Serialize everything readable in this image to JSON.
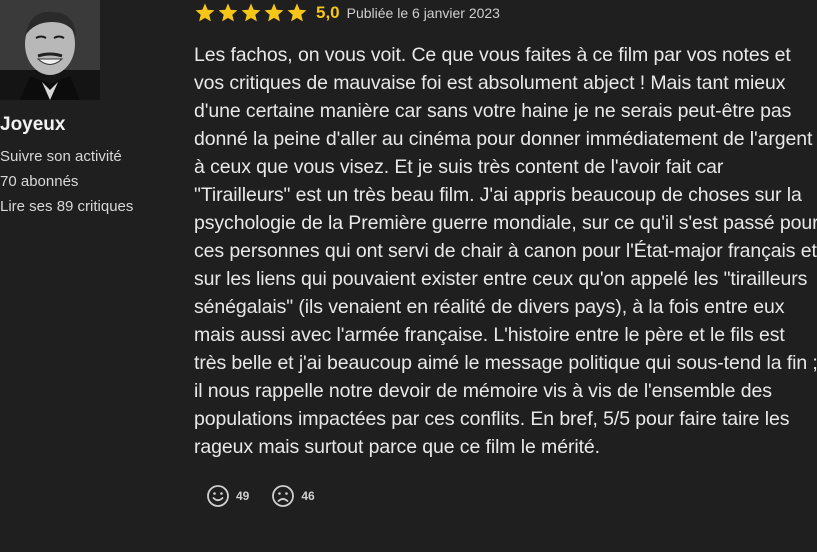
{
  "user": {
    "name": "Joyeux",
    "follow_label": "Suivre son activité",
    "followers_label": "70 abonnés",
    "reviews_label": "Lire ses 89 critiques"
  },
  "review": {
    "rating_value": 5,
    "rating_max": 5,
    "rating_label": "5,0",
    "published": "Publiée le 6 janvier 2023",
    "text": "Les fachos, on vous voit. Ce que vous faites à ce film par vos notes et vos critiques de mauvaise foi est absolument abject ! Mais tant mieux d'une certaine manière car sans votre haine je ne serais peut-être pas donné la peine d'aller au cinéma pour donner immédiatement de l'argent à ceux que vous visez. Et je suis très content de l'avoir fait car \"Tirailleurs\" est un très beau film. J'ai appris beaucoup de choses sur la psychologie de la Première guerre mondiale, sur ce qu'il s'est passé pour ces personnes qui ont servi de chair à canon pour l'État-major français et sur les liens qui pouvaient exister entre ceux qu'on appelé les \"tirailleurs sénégalais\" (ils venaient en réalité de divers pays), à la fois entre eux mais aussi avec l'armée française. L'histoire entre le père et le fils est très belle et j'ai beaucoup aimé le message politique qui sous-tend la fin ; il nous rappelle notre devoir de mémoire vis à vis de l'ensemble des populations impactées par ces conflits. En bref, 5/5 pour faire taire les rageux mais surtout parce que ce film le mérité."
  },
  "reactions": {
    "helpful_count": "49",
    "unhelpful_count": "46",
    "helpful_icon": "smiley-face-icon",
    "unhelpful_icon": "frowning-face-icon"
  },
  "colors": {
    "background": "#1f1f1f",
    "star": "#f5c518",
    "text": "#e8e8e8"
  }
}
